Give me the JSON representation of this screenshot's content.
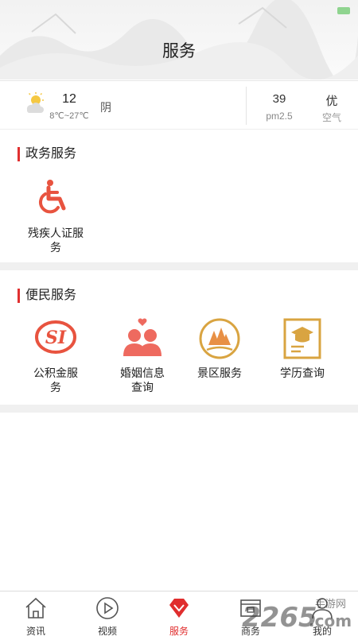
{
  "header": {
    "title": "服务"
  },
  "weather": {
    "temperature": "12",
    "range": "8℃~27℃",
    "condition": "阴",
    "pm_value": "39",
    "pm_label": "pm2.5",
    "aq_value": "优",
    "aq_label": "空气"
  },
  "gov_section": {
    "title": "政务服务",
    "items": [
      {
        "label": "残疾人证服务",
        "icon": "wheelchair-icon"
      }
    ]
  },
  "civil_section": {
    "title": "便民服务",
    "items": [
      {
        "label": "公积金服务",
        "icon": "housing-fund-logo-icon"
      },
      {
        "label": "婚姻信息查询",
        "icon": "couple-heart-icon"
      },
      {
        "label": "景区服务",
        "icon": "mountain-scenic-icon"
      },
      {
        "label": "学历查询",
        "icon": "graduation-cap-icon"
      }
    ]
  },
  "tabs": [
    {
      "label": "资讯",
      "icon": "house-icon"
    },
    {
      "label": "视频",
      "icon": "play-icon"
    },
    {
      "label": "服务",
      "icon": "service-diamond-icon"
    },
    {
      "label": "商务",
      "icon": "business-icon"
    },
    {
      "label": "我的",
      "icon": "person-icon"
    }
  ],
  "watermark": {
    "text_main": "2265",
    "text_domain": ".com",
    "text_cn": "手游网"
  },
  "colors": {
    "accent": "#e02e2e",
    "gold": "#d9a441",
    "coral": "#ee6a5f"
  }
}
